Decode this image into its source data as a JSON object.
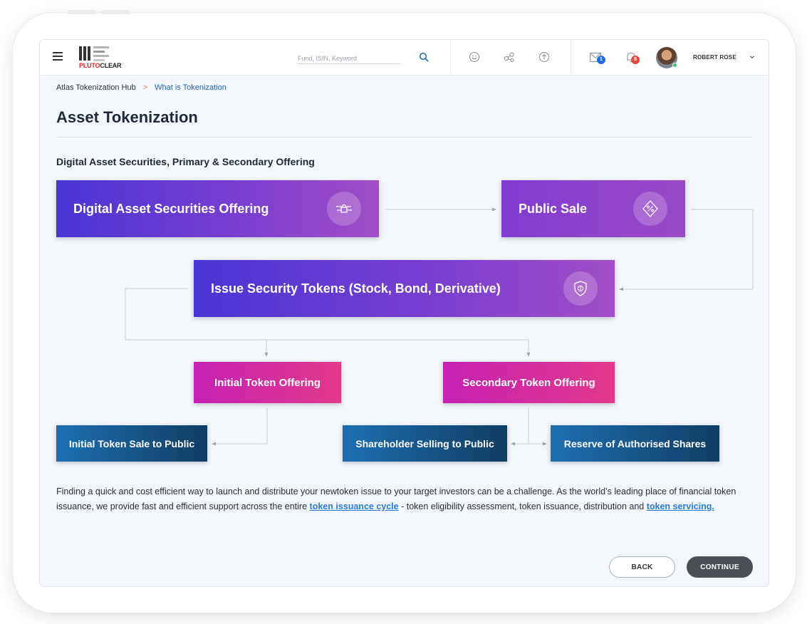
{
  "header": {
    "logo": {
      "word1": "PLUTO",
      "word2": "CLEAR"
    },
    "search_placeholder": "Fund, ISIN, Keyword",
    "messages_count": "1",
    "notifications_count": "8",
    "user_name": "ROBERT ROSE"
  },
  "breadcrumb": {
    "home": "Atlas Tokenization Hub",
    "separator": ">",
    "current": "What is Tokenization"
  },
  "page_title": "Asset Tokenization",
  "section_title": "Digital Asset Securities, Primary & Secondary Offering",
  "flow": {
    "digital_offering": "Digital Asset Securities Offering",
    "public_sale": "Public Sale",
    "issue_tokens": "Issue Security Tokens (Stock, Bond, Derivative)",
    "initial_offering": "Initial Token Offering",
    "secondary_offering": "Secondary Token Offering",
    "initial_sale": "Initial Token Sale to Public",
    "shareholder_selling": "Shareholder Selling to Public",
    "reserve_shares": "Reserve of Authorised Shares"
  },
  "description": {
    "part1": "Finding a quick and cost efficient way to launch and distribute your newtoken issue to your target investors can be a challenge. As the world’s leading place of financial token issuance, we provide fast and efficient support across the entire ",
    "link1": "token issuance cycle",
    "part2": " -  token eligibility assessment, token issuance, distribution and ",
    "link2": "token servicing."
  },
  "buttons": {
    "back": "BACK",
    "continue": "CONTINUE"
  },
  "colors": {
    "purple_start": "#4a35d4",
    "purple_end": "#a24ec8",
    "magenta": "#d02aa8",
    "navy_blue": "#1d6fb2",
    "badge_blue": "#1a6ee6",
    "badge_red": "#e8483c",
    "link": "#2a7ad6"
  }
}
